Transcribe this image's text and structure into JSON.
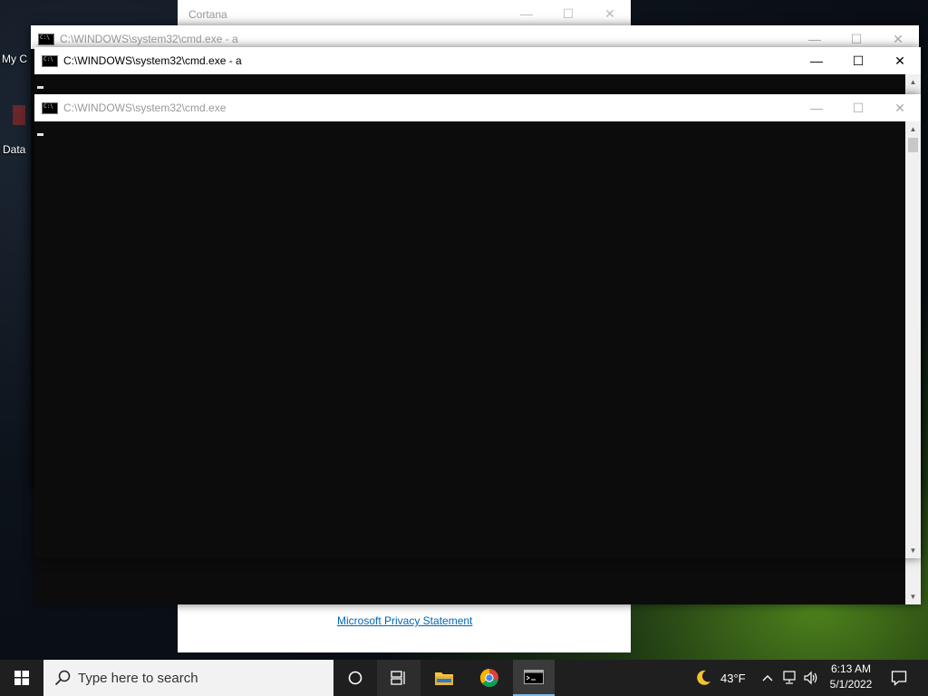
{
  "desktop": {
    "icons": [
      {
        "label": "My C"
      },
      {
        "label": "Data"
      }
    ]
  },
  "cortana": {
    "title": "Cortana",
    "privacy_link": "Microsoft Privacy Statement"
  },
  "windows": {
    "back": {
      "title": "C:\\WINDOWS\\system32\\cmd.exe - a"
    },
    "middle": {
      "title": "C:\\WINDOWS\\system32\\cmd.exe - a"
    },
    "front": {
      "title": "C:\\WINDOWS\\system32\\cmd.exe"
    }
  },
  "window_controls": {
    "minimize": "—",
    "maximize": "☐",
    "close": "✕"
  },
  "taskbar": {
    "search_placeholder": "Type here to search",
    "weather": {
      "temp": "43°F",
      "icon": "moon-icon"
    },
    "clock": {
      "time": "6:13 AM",
      "date": "5/1/2022"
    },
    "pinned": [
      "cortana-circle-icon",
      "task-view-icon",
      "file-explorer-icon",
      "chrome-icon",
      "cmd-icon"
    ]
  },
  "colors": {
    "console_bg": "#0c0c0c",
    "taskbar_bg": "#1f1f1f",
    "link": "#0066b4"
  }
}
